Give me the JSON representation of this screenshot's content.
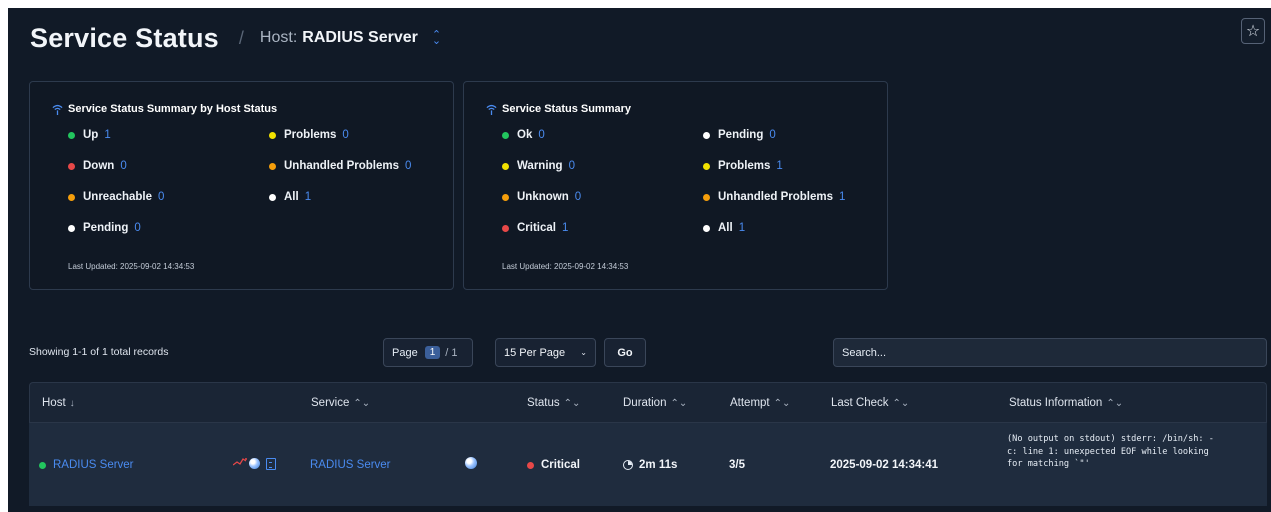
{
  "header": {
    "title": "Service Status",
    "separator": "/",
    "host_label": "Host:",
    "host_name": "RADIUS Server",
    "host_switch_up": "⌃",
    "host_switch_down": "⌄",
    "star_icon": "☆"
  },
  "summary_host": {
    "title": "Service Status Summary by Host Status",
    "icon": "wifi-icon",
    "items": [
      {
        "label": "Up",
        "count": "1",
        "color": "#22c55e"
      },
      {
        "label": "Down",
        "count": "0",
        "color": "#e74848"
      },
      {
        "label": "Unreachable",
        "count": "0",
        "color": "#f59e0b"
      },
      {
        "label": "Pending",
        "count": "0",
        "color": "#ffffff"
      },
      {
        "label": "Problems",
        "count": "0",
        "color": "#f2e100"
      },
      {
        "label": "Unhandled Problems",
        "count": "0",
        "color": "#f59e0b"
      },
      {
        "label": "All",
        "count": "1",
        "color": "#ffffff"
      }
    ],
    "last_updated": "Last Updated: 2025-09-02 14:34:53"
  },
  "summary_service": {
    "title": "Service Status Summary",
    "icon": "wifi-icon",
    "items": [
      {
        "label": "Ok",
        "count": "0",
        "color": "#22c55e"
      },
      {
        "label": "Warning",
        "count": "0",
        "color": "#f2e100"
      },
      {
        "label": "Unknown",
        "count": "0",
        "color": "#f59e0b"
      },
      {
        "label": "Critical",
        "count": "1",
        "color": "#e74848"
      },
      {
        "label": "Pending",
        "count": "0",
        "color": "#ffffff"
      },
      {
        "label": "Problems",
        "count": "1",
        "color": "#f2e100"
      },
      {
        "label": "Unhandled Problems",
        "count": "1",
        "color": "#f59e0b"
      },
      {
        "label": "All",
        "count": "1",
        "color": "#ffffff"
      }
    ],
    "last_updated": "Last Updated: 2025-09-02 14:34:53"
  },
  "toolbar": {
    "showing": "Showing 1-1 of 1 total records",
    "page_label": "Page",
    "page_current": "1",
    "page_total": "/ 1",
    "per_page": "15 Per Page",
    "per_page_caret": "⌄",
    "go_label": "Go",
    "search_placeholder": "Search..."
  },
  "table": {
    "columns": [
      {
        "label": "Host",
        "sort": "↓"
      },
      {
        "label": "Service",
        "sort": "⌃⌄"
      },
      {
        "label": "Status",
        "sort": "⌃⌄"
      },
      {
        "label": "Duration",
        "sort": "⌃⌄"
      },
      {
        "label": "Attempt",
        "sort": "⌃⌄"
      },
      {
        "label": "Last Check",
        "sort": "⌃⌄"
      },
      {
        "label": "Status Information",
        "sort": "⌃⌄"
      }
    ],
    "rows": [
      {
        "host": "RADIUS Server",
        "service": "RADIUS Server",
        "status": "Critical",
        "duration": "2m 11s",
        "attempt": "3/5",
        "last_check": "2025-09-02 14:34:41",
        "status_information": "(No output on stdout) stderr: /bin/sh: -c: line 1: unexpected EOF while looking for matching `\"'"
      }
    ]
  },
  "colors": {
    "up": "#22c55e",
    "critical": "#e74848",
    "accent": "#4a8bf0"
  }
}
